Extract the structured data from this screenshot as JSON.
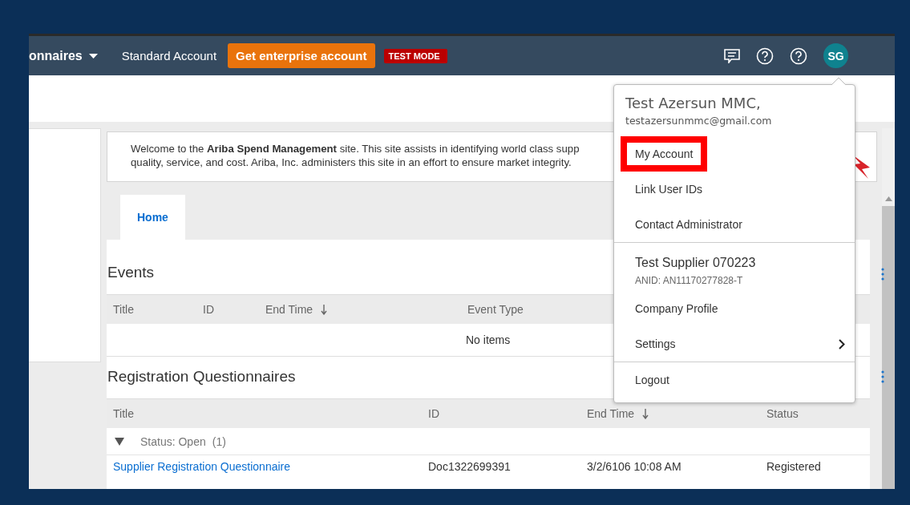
{
  "top_bar": {
    "nav_item": "onnaires",
    "account_type": "Standard Account",
    "upgrade_button": "Get enterprise account",
    "mode_badge": "TEST MODE",
    "avatar": "SG"
  },
  "welcome": {
    "lines": [
      "Welcome to the **Ariba Spend Management** site.  This site assists in identifying world class supp",
      "quality, service, and cost. Ariba, Inc. administers this site in an effort to ensure market integrity."
    ]
  },
  "tabs": [
    {
      "label": "Home",
      "selected": true
    }
  ],
  "events": {
    "title": "Events",
    "columns": [
      {
        "label": "Title",
        "sorted": false
      },
      {
        "label": "ID",
        "sorted": false
      },
      {
        "label": "End Time",
        "sorted": true
      },
      {
        "label": "Event Type",
        "sorted": false
      }
    ],
    "empty": "No items"
  },
  "questionnaires": {
    "title": "Registration Questionnaires",
    "columns": [
      {
        "label": "Title",
        "sorted": false
      },
      {
        "label": "ID",
        "sorted": false
      },
      {
        "label": "End Time",
        "sorted": true
      },
      {
        "label": "Status",
        "sorted": false
      }
    ],
    "groups": [
      {
        "label": "Status: Open",
        "count": "(1)",
        "expanded": true,
        "rows": [
          [
            "Supplier Registration Questionnaire",
            "Doc1322699391",
            "3/2/6106 10:08 AM",
            "Registered"
          ]
        ]
      }
    ]
  },
  "user_menu": {
    "name": "Test Azersun MMC,",
    "email": "testazersunmmc@gmail.com",
    "sections": [
      {
        "items": [
          {
            "kind": "item",
            "label": "My Account",
            "highlighted": true
          },
          {
            "kind": "item",
            "label": "Link User IDs",
            "highlighted": false
          },
          {
            "kind": "item",
            "label": "Contact Administrator",
            "highlighted": false
          }
        ]
      },
      {
        "items": [
          {
            "kind": "company",
            "label": "Test Supplier 070223",
            "highlighted": false
          },
          {
            "kind": "anid",
            "label": "ANID: AN11170277828-T",
            "highlighted": false
          },
          {
            "kind": "item",
            "label": "Company Profile",
            "highlighted": false
          },
          {
            "kind": "submenu",
            "label": "Settings",
            "highlighted": false
          }
        ]
      },
      {
        "items": [
          {
            "kind": "item",
            "label": "Logout",
            "highlighted": false
          }
        ]
      }
    ]
  }
}
